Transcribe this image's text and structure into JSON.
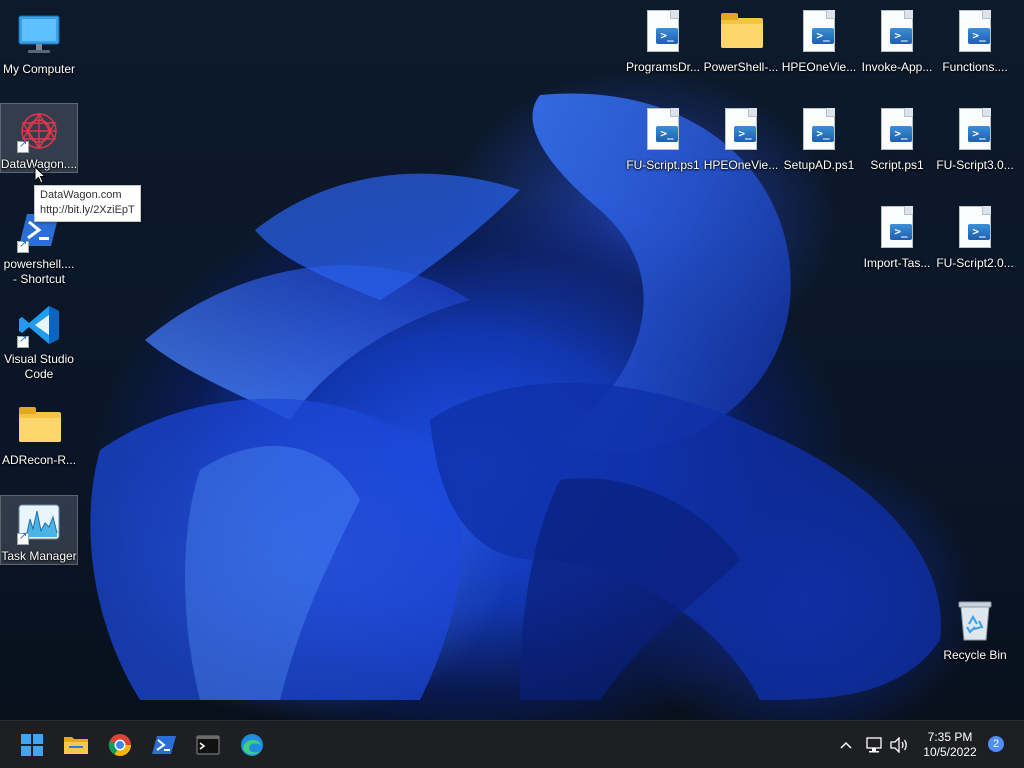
{
  "desktop": {
    "left_icons": [
      {
        "label": "My Computer",
        "icon": "monitor-icon"
      },
      {
        "label": "DataWagon....",
        "icon": "datawagon-icon",
        "selected": true
      },
      {
        "label": "powershell....\n- Shortcut",
        "icon": "powershell-icon"
      },
      {
        "label": "Visual Studio\nCode",
        "icon": "vscode-icon"
      },
      {
        "label": "ADRecon-R...",
        "icon": "folder-icon"
      },
      {
        "label": "Task Manager",
        "icon": "task-manager-icon",
        "selected": true
      }
    ],
    "right_icons_row1": [
      "ProgramsDr...",
      "PowerShell-...",
      "HPEOneVie...",
      "Invoke-App...",
      "Functions...."
    ],
    "right_icons_row2": [
      "FU-Script.ps1",
      "HPEOneVie...",
      "SetupAD.ps1",
      "Script.ps1",
      "FU-Script3.0..."
    ],
    "right_icons_row3": [
      "Import-Tas...",
      "FU-Script2.0..."
    ],
    "recycle_bin": {
      "label": "Recycle Bin",
      "icon": "recycle-bin-icon"
    }
  },
  "tooltip": {
    "line1": "DataWagon.com",
    "line2": "http://bit.ly/2XziEpT"
  },
  "taskbar": {
    "apps": [
      "start-icon",
      "file-explorer-icon",
      "chrome-icon",
      "powershell-icon",
      "terminal-icon",
      "edge-icon"
    ],
    "tray": {
      "time": "7:35 PM",
      "date": "10/5/2022",
      "notification_count": "2"
    }
  },
  "colors": {
    "accent": "#1a4fe0",
    "taskbar": "#1e1f22",
    "folder": "#f5c542",
    "notif": "#4f8ef7"
  }
}
